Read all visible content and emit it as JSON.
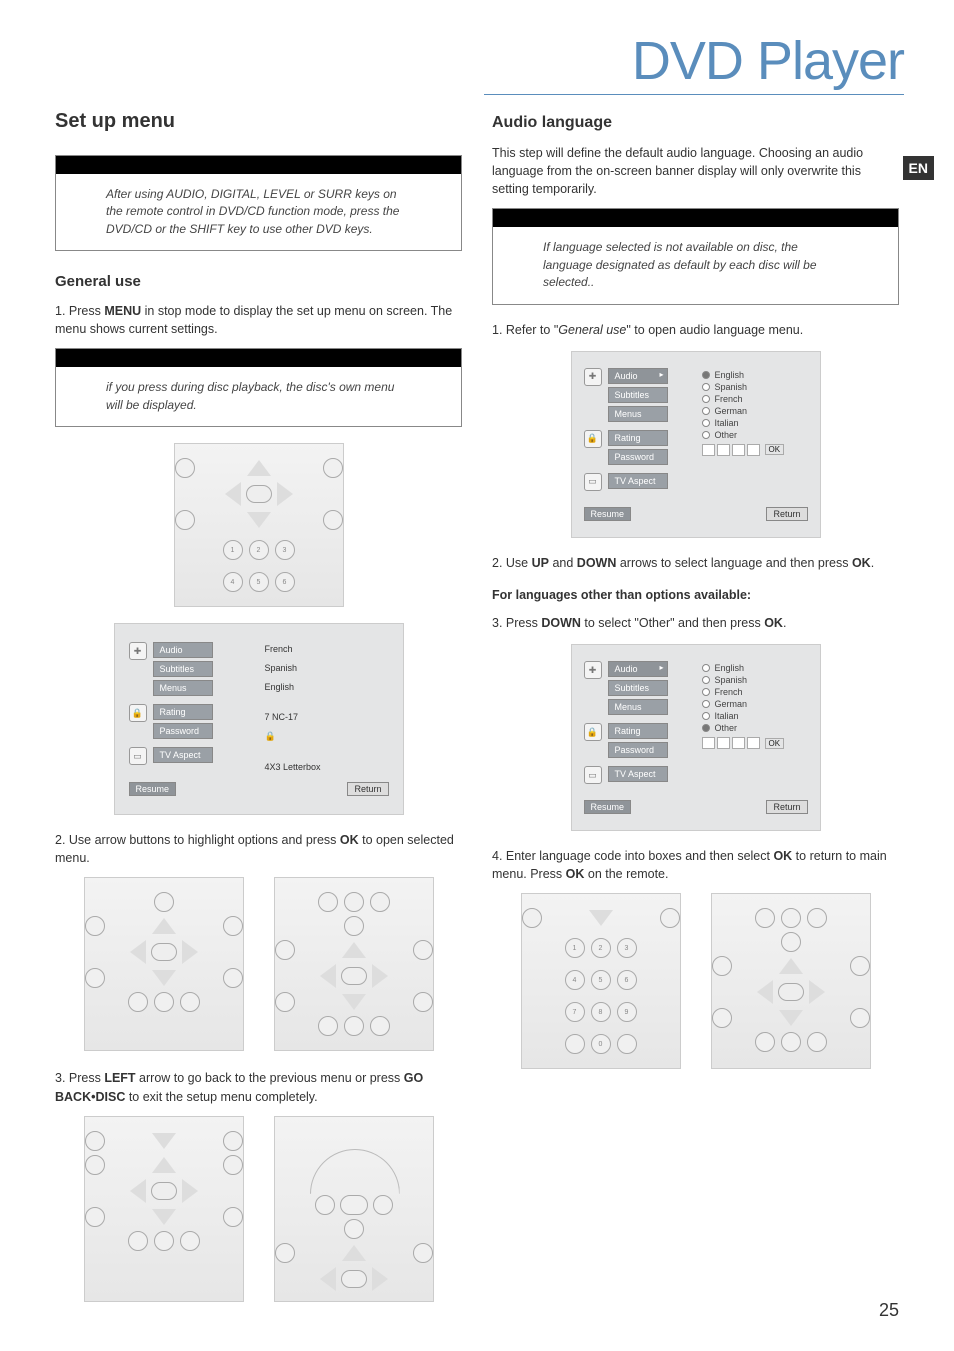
{
  "header": {
    "page_title": "DVD Player",
    "lang_badge": "EN"
  },
  "left": {
    "section_title": "Set up menu",
    "note1": "After using AUDIO, DIGITAL, LEVEL or SURR keys on the remote control in DVD/CD function mode, press the DVD/CD or the SHIFT key to use other DVD keys.",
    "general_use_heading": "General use",
    "step1_pre": "1. Press ",
    "step1_bold": "MENU",
    "step1_post": " in stop mode to display the set up menu on screen. The menu shows current settings.",
    "note2": "if you press during disc playback, the disc's own menu will be displayed.",
    "menu1": {
      "audio": "Audio",
      "subtitles": "Subtitles",
      "menus": "Menus",
      "rating": "Rating",
      "password": "Password",
      "tvaspect": "TV Aspect",
      "v_audio": "French",
      "v_subtitles": "Spanish",
      "v_menus": "English",
      "v_rating": "7 NC-17",
      "v_password": "🔒",
      "v_tvaspect": "4X3 Letterbox",
      "resume": "Resume",
      "return": "Return"
    },
    "step2_pre": "2. Use arrow buttons to highlight options and press ",
    "step2_bold": "OK",
    "step2_post": " to open selected menu.",
    "step3_pre": "3.  Press ",
    "step3_bold1": "LEFT",
    "step3_mid": " arrow to go back to the previous menu or press ",
    "step3_bold2": "GO BACK•DISC",
    "step3_post": " to exit the setup menu completely."
  },
  "right": {
    "section_title": "Audio language",
    "intro": "This step will define the default audio language. Choosing an audio language from the on-screen banner display will only overwrite this setting temporarily.",
    "note": "If language selected is not available on disc, the language designated as default  by each disc will be selected..",
    "step1_pre": "1. Refer to \"",
    "step1_italic": "General use",
    "step1_post": "\" to open audio language menu.",
    "menu_opts": {
      "english": "English",
      "spanish": "Spanish",
      "french": "French",
      "german": "German",
      "italian": "Italian",
      "other": "Other",
      "ok": "OK"
    },
    "step2_pre": "2. Use ",
    "step2_b1": "UP",
    "step2_mid": " and ",
    "step2_b2": "DOWN",
    "step2_mid2": " arrows to select language and then press ",
    "step2_b3": "OK",
    "step2_post": ".",
    "other_heading": "For languages other than options available:",
    "step3_pre": "3. Press ",
    "step3_b1": "DOWN",
    "step3_mid": " to select \"Other\" and then press ",
    "step3_b2": "OK",
    "step3_post": ".",
    "step4_pre": "4. Enter language code into boxes and then select ",
    "step4_b1": "OK",
    "step4_mid": " to return to main menu. Press ",
    "step4_b2": "OK",
    "step4_post": " on the remote."
  },
  "pagenum": "25"
}
